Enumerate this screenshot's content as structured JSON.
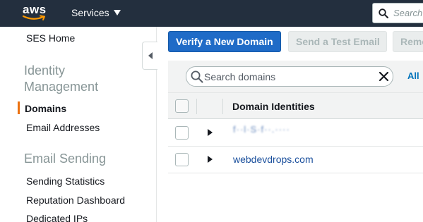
{
  "topbar": {
    "logo_text": "aws",
    "services_label": "Services",
    "search_placeholder": "Search"
  },
  "sidebar": {
    "home_link": "SES Home",
    "identity_heading_line1": "Identity",
    "identity_heading_line2": "Management",
    "items_identity": [
      "Domains",
      "Email Addresses"
    ],
    "active_item": "Domains",
    "sending_heading": "Email Sending",
    "items_sending": [
      "Sending Statistics",
      "Reputation Dashboard",
      "Dedicated IPs"
    ]
  },
  "toolbar": {
    "verify_label": "Verify a New Domain",
    "test_label": "Send a Test Email",
    "remove_label": "Remove"
  },
  "filter": {
    "search_placeholder": "Search domains",
    "all_link": "All"
  },
  "table": {
    "column_header": "Domain Identities",
    "rows": [
      {
        "domain": "f··l·S·f··.····"
      },
      {
        "domain": "webdevdrops.com"
      }
    ]
  },
  "colors": {
    "topbar": "#232f3e",
    "primary_button": "#1f6bc7",
    "active_marker": "#ec7211",
    "link": "#1a4f9c"
  },
  "icons": [
    "aws-logo-icon",
    "caret-down-icon",
    "search-icon",
    "collapse-arrow-icon",
    "clear-icon",
    "expand-arrow-icon",
    "checkbox-icon"
  ]
}
